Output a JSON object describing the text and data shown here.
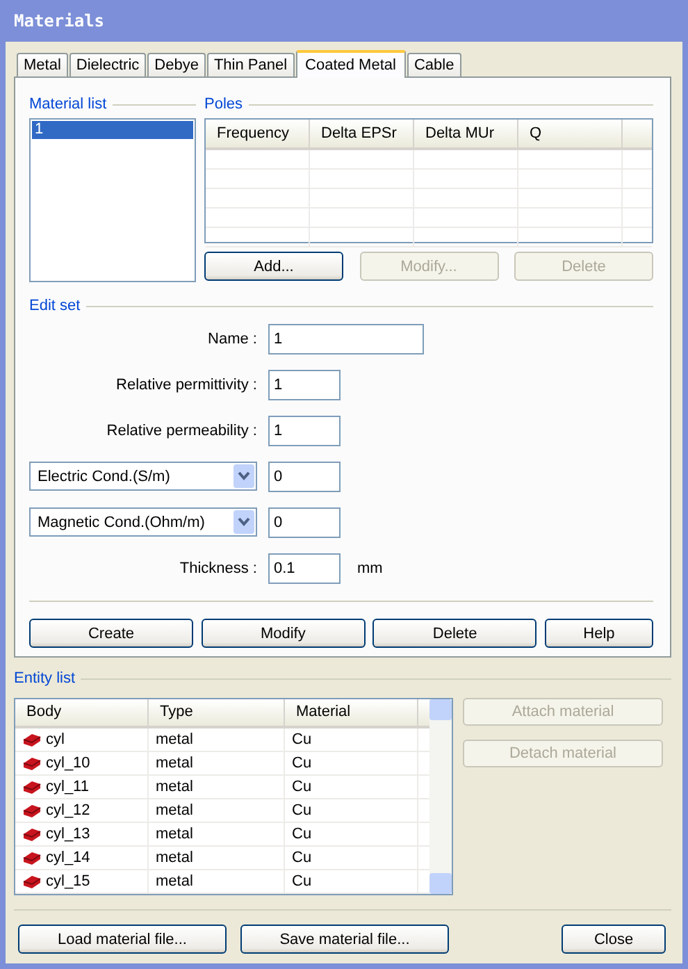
{
  "window": {
    "title": "Materials"
  },
  "tabs": [
    {
      "label": "Metal",
      "selected": false
    },
    {
      "label": "Dielectric",
      "selected": false
    },
    {
      "label": "Debye",
      "selected": false
    },
    {
      "label": "Thin Panel",
      "selected": false
    },
    {
      "label": "Coated Metal",
      "selected": true
    },
    {
      "label": "Cable",
      "selected": false
    }
  ],
  "material_list": {
    "label": "Material list",
    "items": [
      {
        "label": "1",
        "selected": true
      }
    ]
  },
  "poles": {
    "label": "Poles",
    "columns": [
      "Frequency",
      "Delta EPSr",
      "Delta MUr",
      "Q"
    ],
    "buttons": [
      {
        "label": "Add...",
        "disabled": false
      },
      {
        "label": "Modify...",
        "disabled": true
      },
      {
        "label": "Delete",
        "disabled": true
      }
    ]
  },
  "edit_set": {
    "label": "Edit set",
    "fields": [
      {
        "kind": "longtext",
        "label": "Name :",
        "value": "1"
      },
      {
        "kind": "text",
        "label": "Relative permittivity :",
        "value": "1"
      },
      {
        "kind": "text",
        "label": "Relative permeability :",
        "value": "1"
      },
      {
        "kind": "select",
        "label": "Electric Cond.(S/m)",
        "value": "0"
      },
      {
        "kind": "select",
        "label": "Magnetic Cond.(Ohm/m)",
        "value": "0"
      },
      {
        "kind": "text",
        "label": "Thickness :",
        "value": "0.1",
        "unit": "mm"
      }
    ],
    "buttons": [
      {
        "label": "Create",
        "disabled": false
      },
      {
        "label": "Modify",
        "disabled": false
      },
      {
        "label": "Delete",
        "disabled": false
      },
      {
        "label": "Help",
        "disabled": false
      }
    ]
  },
  "entity_list": {
    "label": "Entity list",
    "columns": [
      "Body",
      "Type",
      "Material"
    ],
    "rows": [
      {
        "body": "cyl",
        "type": "metal",
        "material": "Cu"
      },
      {
        "body": "cyl_10",
        "type": "metal",
        "material": "Cu"
      },
      {
        "body": "cyl_11",
        "type": "metal",
        "material": "Cu"
      },
      {
        "body": "cyl_12",
        "type": "metal",
        "material": "Cu"
      },
      {
        "body": "cyl_13",
        "type": "metal",
        "material": "Cu"
      },
      {
        "body": "cyl_14",
        "type": "metal",
        "material": "Cu"
      },
      {
        "body": "cyl_15",
        "type": "metal",
        "material": "Cu"
      }
    ],
    "buttons": [
      {
        "label": "Attach material",
        "disabled": true
      },
      {
        "label": "Detach material",
        "disabled": true
      }
    ]
  },
  "footer_buttons": [
    {
      "label": "Load material file...",
      "disabled": false
    },
    {
      "label": "Save material file...",
      "disabled": false
    },
    {
      "label": "Close",
      "disabled": false
    }
  ]
}
